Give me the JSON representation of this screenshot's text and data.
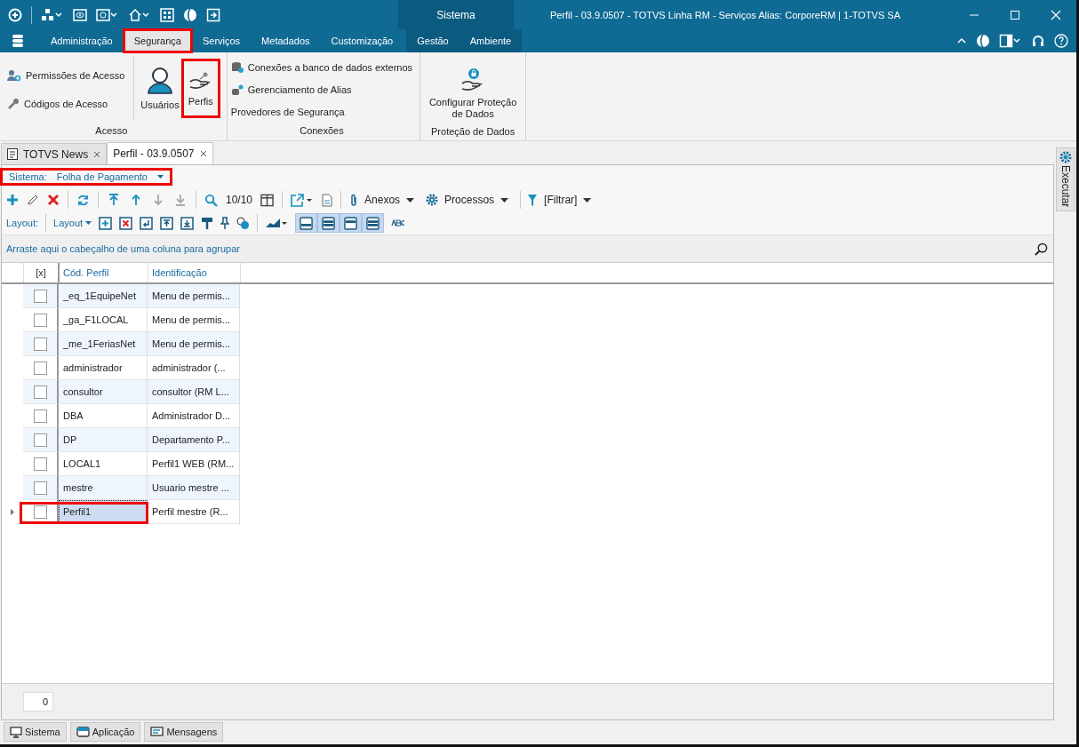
{
  "window": {
    "title": "Perfil - 03.9.0507 - TOTVS Linha RM - Serviços  Alias: CorporeRM | 1-TOTVS SA",
    "context_label": "Sistema"
  },
  "menu": {
    "tabs": [
      {
        "label": "Administração",
        "selected": false,
        "highlighted": false
      },
      {
        "label": "Segurança",
        "selected": true,
        "highlighted": true
      },
      {
        "label": "Serviços",
        "selected": false,
        "highlighted": false
      },
      {
        "label": "Metadados",
        "selected": false,
        "highlighted": false
      },
      {
        "label": "Customização",
        "selected": false,
        "highlighted": false
      },
      {
        "label": "Gestão",
        "selected": false,
        "highlighted": false
      },
      {
        "label": "Ambiente",
        "selected": false,
        "highlighted": false
      }
    ]
  },
  "ribbon": {
    "acesso": {
      "label": "Acesso",
      "small_items": [
        "Permissões de Acesso",
        "Códigos de Acesso"
      ],
      "large_items": [
        {
          "label": "Usuários",
          "highlighted": false
        },
        {
          "label": "Perfis",
          "highlighted": true
        }
      ]
    },
    "conexoes": {
      "label": "Conexões",
      "items": [
        "Conexões a banco de dados externos",
        "Gerenciamento de Alias",
        "Provedores de Segurança"
      ]
    },
    "protecao": {
      "label": "Proteção de Dados",
      "button": "Configurar Proteção de Dados"
    }
  },
  "doc_tabs": [
    {
      "label": "TOTVS News",
      "selected": false
    },
    {
      "label": "Perfil - 03.9.0507",
      "selected": true
    }
  ],
  "filter": {
    "label": "Sistema:",
    "value": "Folha de Pagamento",
    "highlighted": true
  },
  "toolbar": {
    "navigation": [
      {
        "disabled": false
      },
      {
        "disabled": false
      },
      {
        "disabled": true
      },
      {
        "disabled": true
      }
    ],
    "record_count": "10/10",
    "menus": [
      "Anexos",
      "Processos",
      "[Filtrar]"
    ]
  },
  "layout_bar": {
    "label": "Layout:",
    "menu": "Layout",
    "view_toggles": [
      {
        "selected": true
      },
      {
        "selected": true
      },
      {
        "selected": true
      },
      {
        "selected": true
      }
    ]
  },
  "group_panel": {
    "hint": "Arraste aqui o cabeçalho de uma coluna para agrupar"
  },
  "table": {
    "columns": [
      "[x]",
      "Cód. Perfil",
      "Identificação"
    ],
    "rows": [
      {
        "checked": false,
        "selected": false,
        "highlighted": false,
        "code": "_eq_1EquipeNet",
        "identification": "Menu de permis..."
      },
      {
        "checked": false,
        "selected": false,
        "highlighted": false,
        "code": "_ga_F1LOCAL",
        "identification": "Menu de permis..."
      },
      {
        "checked": false,
        "selected": false,
        "highlighted": false,
        "code": "_me_1FeriasNet",
        "identification": "Menu de permis..."
      },
      {
        "checked": false,
        "selected": false,
        "highlighted": false,
        "code": "administrador",
        "identification": "administrador (..."
      },
      {
        "checked": false,
        "selected": false,
        "highlighted": false,
        "code": "consultor",
        "identification": "consultor (RM L..."
      },
      {
        "checked": false,
        "selected": false,
        "highlighted": false,
        "code": "DBA",
        "identification": "Administrador D..."
      },
      {
        "checked": false,
        "selected": false,
        "highlighted": false,
        "code": "DP",
        "identification": "Departamento P..."
      },
      {
        "checked": false,
        "selected": false,
        "highlighted": false,
        "code": "LOCAL1",
        "identification": "Perfil1 WEB (RM..."
      },
      {
        "checked": false,
        "selected": false,
        "highlighted": false,
        "code": "mestre",
        "identification": "Usuario mestre ..."
      },
      {
        "checked": false,
        "selected": true,
        "highlighted": true,
        "code": "Perfil1",
        "identification": "Perfil mestre (R..."
      }
    ]
  },
  "footer": {
    "count": "0"
  },
  "side_panel": {
    "label": "Executar"
  },
  "bottom_tabs": [
    "Sistema",
    "Aplicação",
    "Mensagens"
  ]
}
